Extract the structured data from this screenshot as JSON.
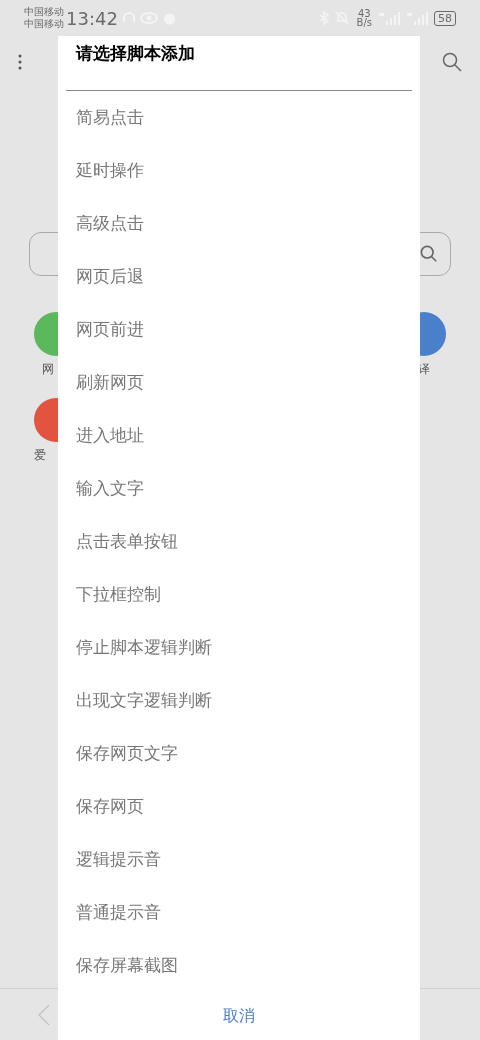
{
  "status_bar": {
    "carriers": [
      "中国移动",
      "中国移动"
    ],
    "time": "13:42",
    "speed": "43",
    "speed_unit": "B/s",
    "battery": "58"
  },
  "background": {
    "shortcut_labels": [
      {
        "label": "网"
      },
      {
        "label": "译"
      },
      {
        "label": "爱"
      }
    ]
  },
  "dialog": {
    "title": "请选择脚本添加",
    "items": [
      {
        "label": "简易点击"
      },
      {
        "label": "延时操作"
      },
      {
        "label": "高级点击"
      },
      {
        "label": "网页后退"
      },
      {
        "label": "网页前进"
      },
      {
        "label": "刷新网页"
      },
      {
        "label": "进入地址"
      },
      {
        "label": "输入文字"
      },
      {
        "label": "点击表单按钮"
      },
      {
        "label": "下拉框控制"
      },
      {
        "label": "停止脚本逻辑判断"
      },
      {
        "label": "出现文字逻辑判断"
      },
      {
        "label": "保存网页文字"
      },
      {
        "label": "保存网页"
      },
      {
        "label": "逻辑提示音"
      },
      {
        "label": "普通提示音"
      },
      {
        "label": "保存屏幕截图"
      }
    ],
    "cancel": "取消"
  }
}
